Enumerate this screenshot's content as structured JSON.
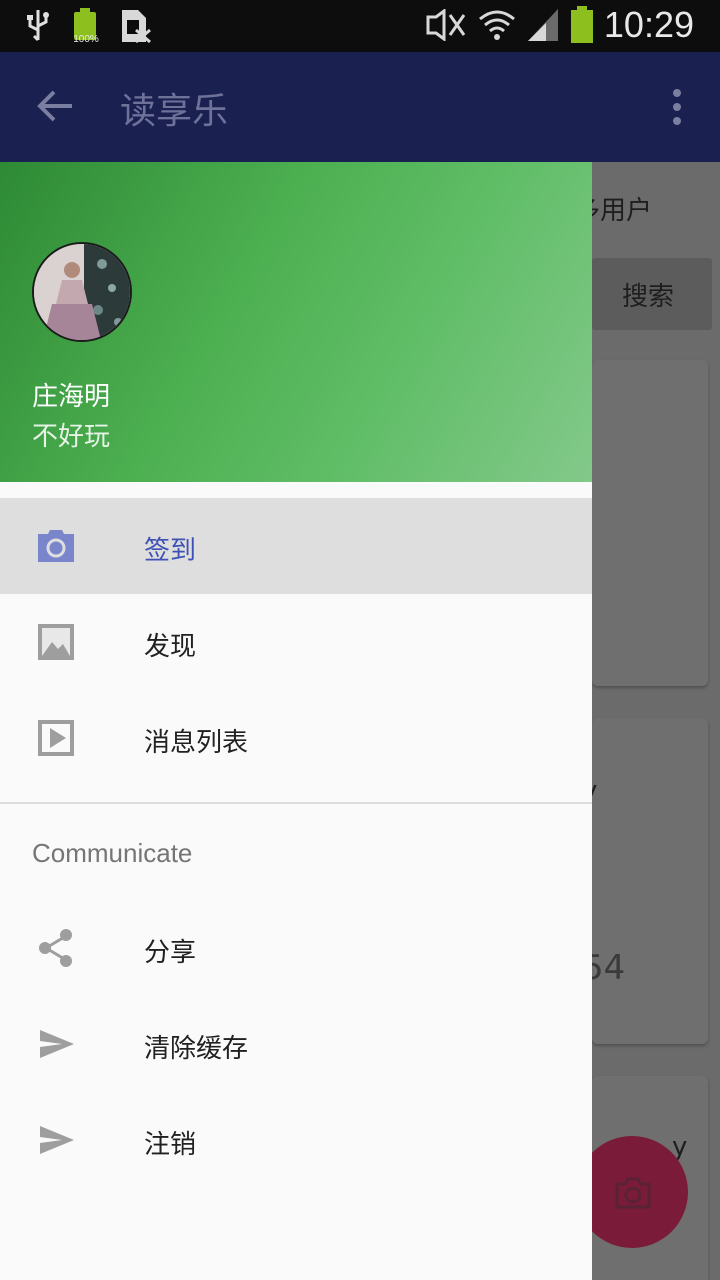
{
  "status_bar": {
    "battery_small_pct": "100%",
    "time": "10:29"
  },
  "appbar": {
    "title": "读享乐"
  },
  "background": {
    "partial_text_user": "多用户",
    "search_button": "搜索",
    "partial_text_v1": "y",
    "partial_number": "54",
    "partial_text_v2": "y"
  },
  "drawer": {
    "user": {
      "name": "庄海明",
      "subtitle": "不好玩"
    },
    "items": [
      {
        "label": "签到",
        "icon": "camera-icon",
        "active": true
      },
      {
        "label": "发现",
        "icon": "image-icon",
        "active": false
      },
      {
        "label": "消息列表",
        "icon": "slideshow-icon",
        "active": false
      }
    ],
    "section_title": "Communicate",
    "section_items": [
      {
        "label": "分享",
        "icon": "share-icon"
      },
      {
        "label": "清除缓存",
        "icon": "send-icon"
      },
      {
        "label": "注销",
        "icon": "send-icon"
      }
    ]
  },
  "colors": {
    "primary": "#1a237e",
    "accent": "#e91e63",
    "active_item_text": "#3f51b5",
    "header_green": "#4caf50"
  }
}
